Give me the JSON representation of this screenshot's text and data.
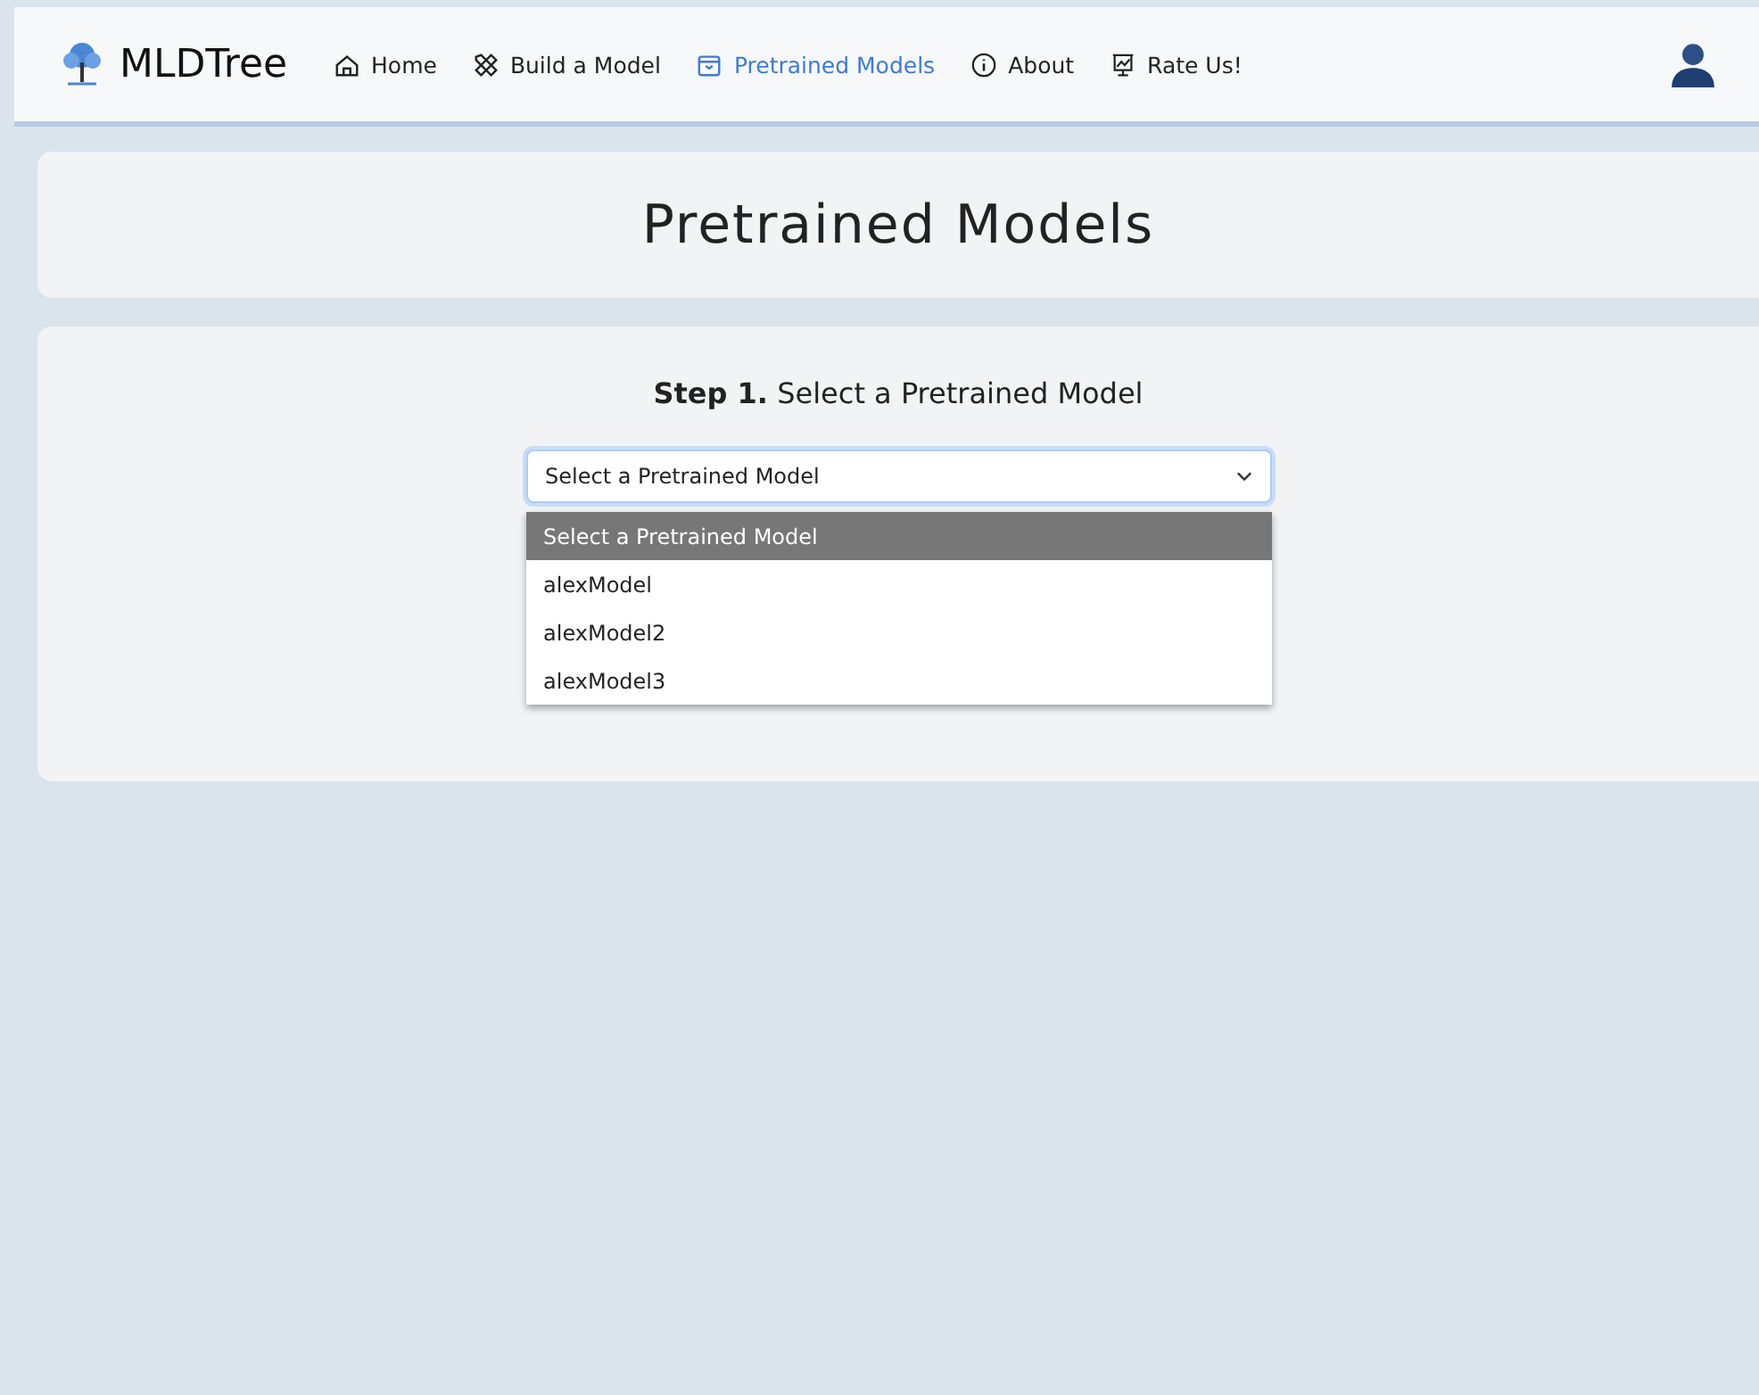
{
  "navbar": {
    "brand": "MLDTree",
    "items": [
      {
        "label": "Home",
        "selected": false
      },
      {
        "label": "Build a Model",
        "selected": false
      },
      {
        "label": "Pretrained Models",
        "selected": true
      },
      {
        "label": "About",
        "selected": false
      },
      {
        "label": "Rate Us!",
        "selected": false
      }
    ]
  },
  "page_title": "Pretrained Models",
  "step": {
    "heading": "**Step 1.** Select a Pretrained Model",
    "select": {
      "value": "Select a Pretrained Model",
      "expanded": true,
      "options": [
        {
          "label": "Select a Pretrained Model",
          "selected": true
        },
        {
          "label": "alexModel",
          "selected": false
        },
        {
          "label": "alexModel2",
          "selected": false
        },
        {
          "label": "alexModel3",
          "selected": false
        }
      ]
    }
  }
}
